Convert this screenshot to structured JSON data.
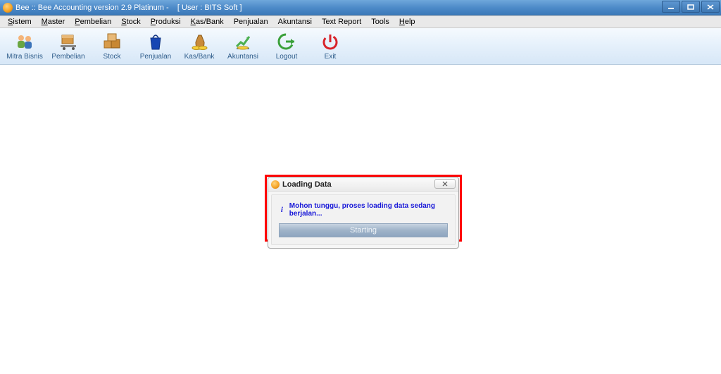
{
  "window": {
    "title": "Bee :: Bee Accounting version 2.9 Platinum -    [ User : BITS Soft ]"
  },
  "menus": [
    {
      "label": "Sistem",
      "mn": "S"
    },
    {
      "label": "Master",
      "mn": "M"
    },
    {
      "label": "Pembelian",
      "mn": "P"
    },
    {
      "label": "Stock",
      "mn": "S"
    },
    {
      "label": "Produksi",
      "mn": "P"
    },
    {
      "label": "Kas/Bank",
      "mn": "K"
    },
    {
      "label": "Penjualan",
      "mn": ""
    },
    {
      "label": "Akuntansi",
      "mn": ""
    },
    {
      "label": "Text Report",
      "mn": ""
    },
    {
      "label": "Tools",
      "mn": ""
    },
    {
      "label": "Help",
      "mn": "H"
    }
  ],
  "toolbar": [
    {
      "name": "mitra-bisnis",
      "label": "Mitra Bisnis",
      "icon": "people-icon"
    },
    {
      "name": "pembelian",
      "label": "Pembelian",
      "icon": "box-cart-icon"
    },
    {
      "name": "stock",
      "label": "Stock",
      "icon": "boxes-icon"
    },
    {
      "name": "penjualan",
      "label": "Penjualan",
      "icon": "shopping-bag-icon"
    },
    {
      "name": "kas-bank",
      "label": "Kas/Bank",
      "icon": "money-bag-icon"
    },
    {
      "name": "akuntansi",
      "label": "Akuntansi",
      "icon": "chart-up-icon"
    },
    {
      "name": "logout",
      "label": "Logout",
      "icon": "logout-icon"
    },
    {
      "name": "exit",
      "label": "Exit",
      "icon": "power-icon"
    }
  ],
  "modal": {
    "title": "Loading Data",
    "message": "Mohon tunggu, proses loading data sedang berjalan...",
    "progress_text": "Starting"
  }
}
